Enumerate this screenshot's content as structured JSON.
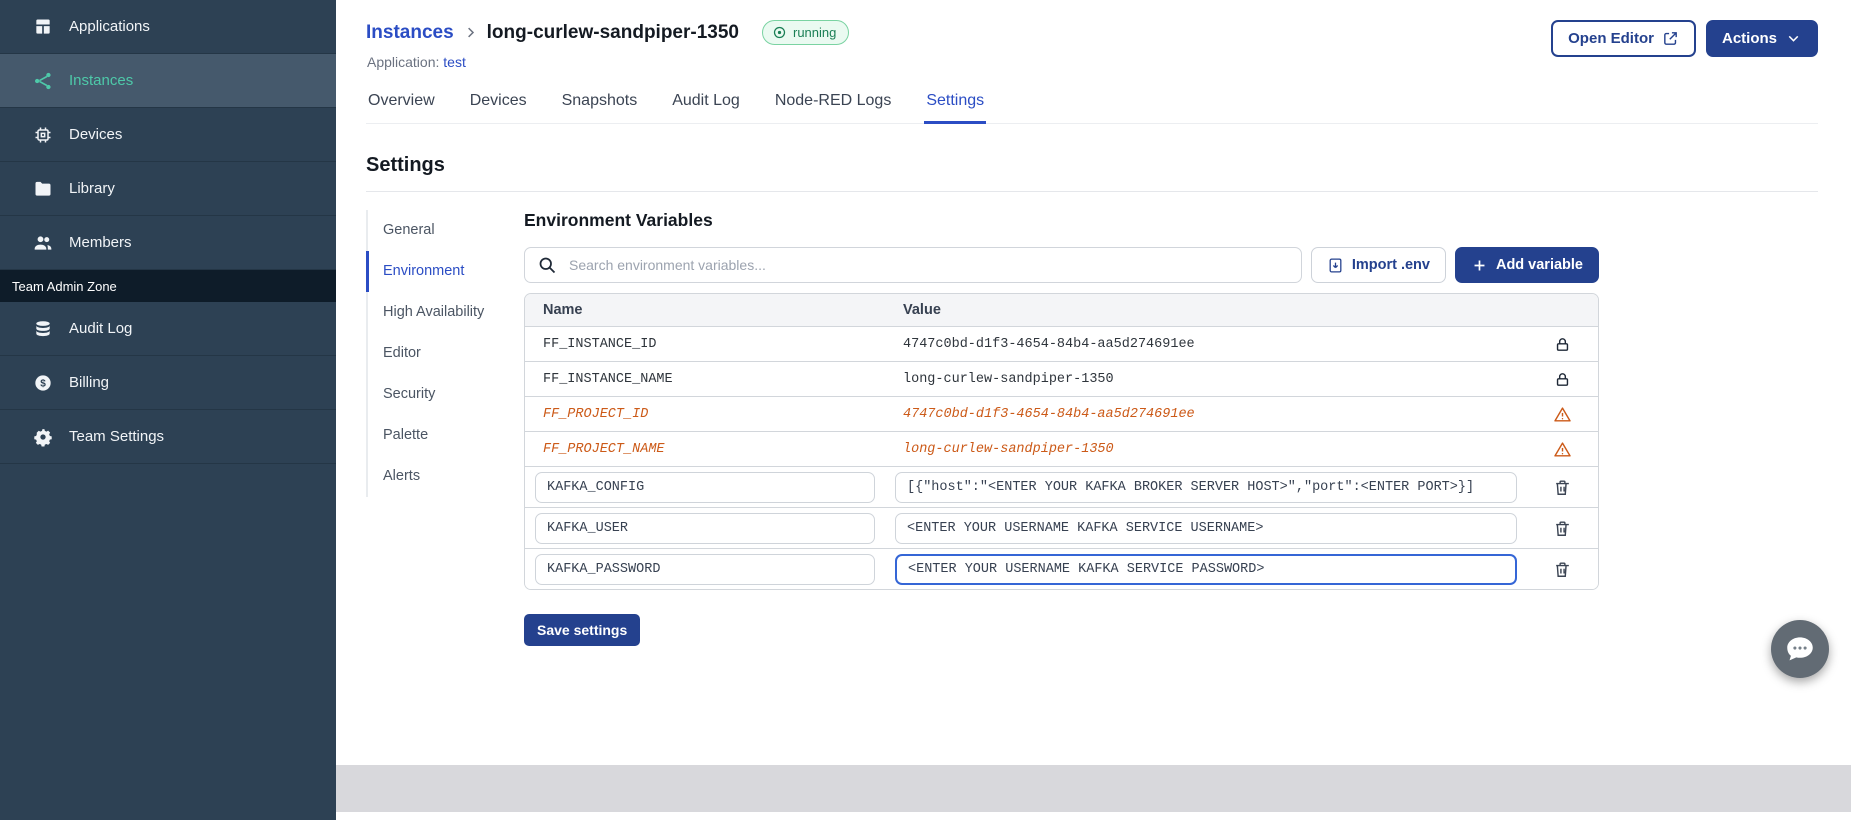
{
  "colors": {
    "sidebar_bg": "#2d4154",
    "sidebar_active_text": "#4ec9a9",
    "primary_button": "#24418e",
    "link": "#2b4dc4",
    "deprecated_warning": "#cc5a18",
    "running_badge_text": "#1a7f55",
    "running_badge_bg": "#eafaf1"
  },
  "sidebar": {
    "items": [
      {
        "label": "Applications"
      },
      {
        "label": "Instances"
      },
      {
        "label": "Devices"
      },
      {
        "label": "Library"
      },
      {
        "label": "Members"
      }
    ],
    "admin_zone_label": "Team Admin Zone",
    "admin_items": [
      {
        "label": "Audit Log"
      },
      {
        "label": "Billing"
      },
      {
        "label": "Team Settings"
      }
    ]
  },
  "header": {
    "breadcrumb_parent": "Instances",
    "instance_name": "long-curlew-sandpiper-1350",
    "status": "running",
    "application_label": "Application:",
    "application_name": "test",
    "open_editor_label": "Open Editor",
    "actions_label": "Actions"
  },
  "tabs": [
    "Overview",
    "Devices",
    "Snapshots",
    "Audit Log",
    "Node-RED Logs",
    "Settings"
  ],
  "settings": {
    "title": "Settings",
    "nav": [
      "General",
      "Environment",
      "High Availability",
      "Editor",
      "Security",
      "Palette",
      "Alerts"
    ],
    "panel_title": "Environment Variables",
    "search_placeholder": "Search environment variables...",
    "import_button": "Import .env",
    "add_button": "Add variable",
    "table": {
      "headers": [
        "Name",
        "Value"
      ],
      "rows": [
        {
          "name": "FF_INSTANCE_ID",
          "value": "4747c0bd-d1f3-4654-84b4-aa5d274691ee",
          "kind": "locked"
        },
        {
          "name": "FF_INSTANCE_NAME",
          "value": "long-curlew-sandpiper-1350",
          "kind": "locked"
        },
        {
          "name": "FF_PROJECT_ID",
          "value": "4747c0bd-d1f3-4654-84b4-aa5d274691ee",
          "kind": "deprecated"
        },
        {
          "name": "FF_PROJECT_NAME",
          "value": "long-curlew-sandpiper-1350",
          "kind": "deprecated"
        },
        {
          "name": "KAFKA_CONFIG",
          "value": "[{\"host\":\"<ENTER YOUR KAFKA BROKER SERVER HOST>\",\"port\":<ENTER PORT>}]",
          "kind": "editable"
        },
        {
          "name": "KAFKA_USER",
          "value": "<ENTER YOUR USERNAME KAFKA SERVICE USERNAME>",
          "kind": "editable"
        },
        {
          "name": "KAFKA_PASSWORD",
          "value": "<ENTER YOUR USERNAME KAFKA SERVICE PASSWORD>",
          "kind": "editable",
          "focused": true
        }
      ]
    },
    "save_button": "Save settings"
  }
}
